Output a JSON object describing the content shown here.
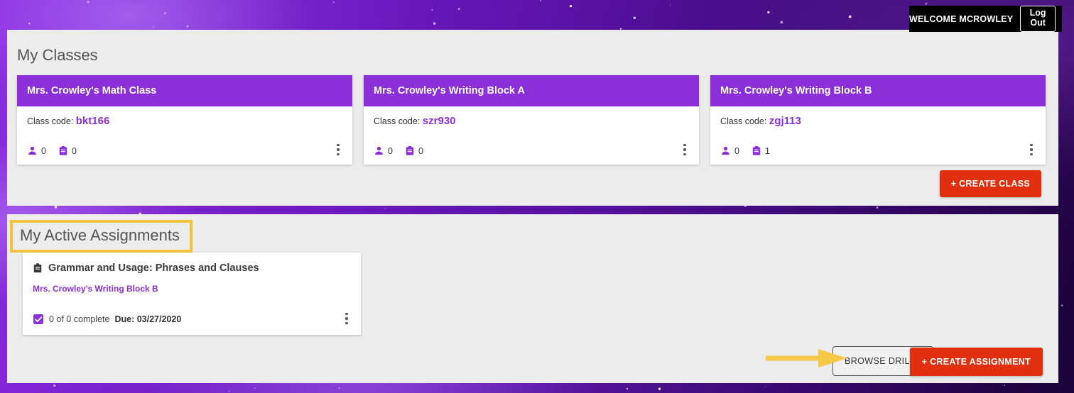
{
  "header": {
    "welcome_text": "WELCOME MCROWLEY",
    "logout_label": "Log Out"
  },
  "classes_section": {
    "title": "My Classes",
    "class_code_label": "Class code:",
    "create_class_label": "+ CREATE CLASS",
    "cards": [
      {
        "name": "Mrs. Crowley's Math Class",
        "code": "bkt166",
        "student_count": "0",
        "assignment_count": "0"
      },
      {
        "name": "Mrs. Crowley's Writing Block A",
        "code": "szr930",
        "student_count": "0",
        "assignment_count": "0"
      },
      {
        "name": "Mrs. Crowley's Writing Block B",
        "code": "zgj113",
        "student_count": "0",
        "assignment_count": "1"
      }
    ]
  },
  "assignments_section": {
    "title": "My Active Assignments",
    "browse_drills_label": "BROWSE DRILLS",
    "create_assignment_label": "+ CREATE ASSIGNMENT",
    "cards": [
      {
        "title": "Grammar and Usage: Phrases and Clauses",
        "class_name": "Mrs. Crowley's Writing Block B",
        "progress": "0 of 0 complete",
        "due": "Due: 03/27/2020"
      }
    ]
  },
  "colors": {
    "brand_purple": "#8b30d8",
    "accent_red": "#e03010",
    "highlight_yellow": "#f5c33b",
    "panel_gray": "#ececec"
  },
  "annotations": {
    "highlight_target": "My Active Assignments",
    "arrow_target": "BROWSE DRILLS"
  }
}
